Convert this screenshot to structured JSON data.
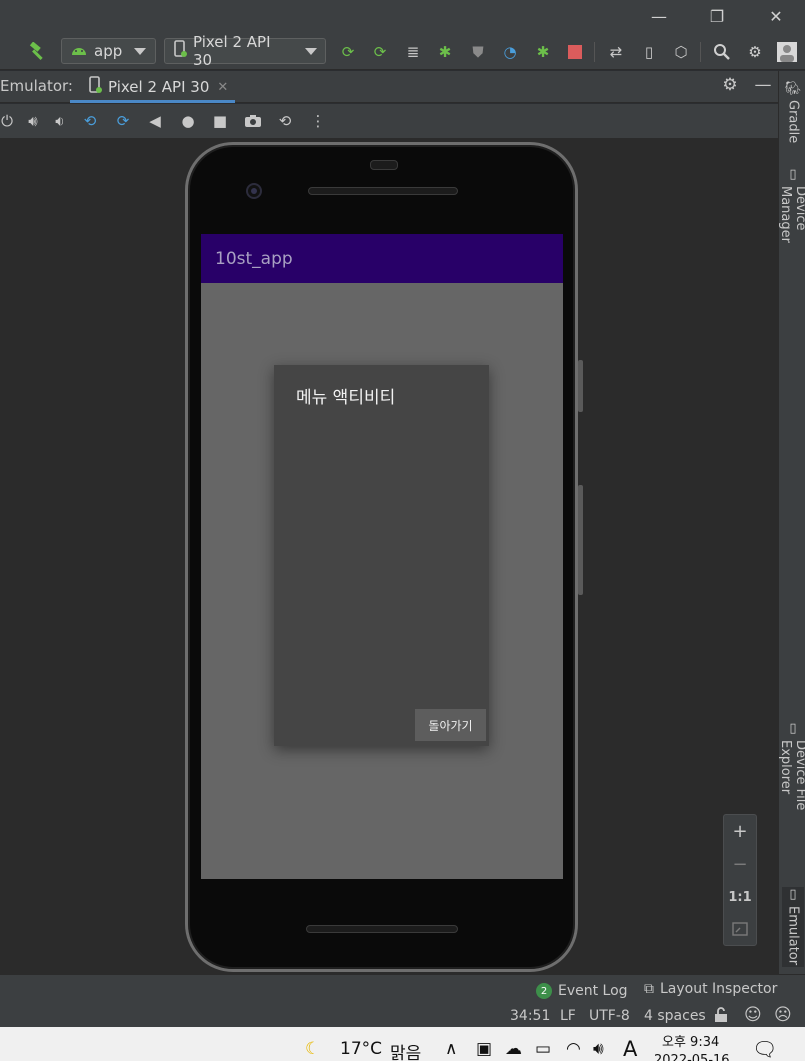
{
  "toolbar": {
    "run_config": "app",
    "device": "Pixel 2 API 30"
  },
  "tabs": {
    "emulator_label": "Emulator:",
    "device_tab": "Pixel 2 API 30",
    "close_glyph": "✕"
  },
  "side_panels": {
    "gradle": "Gradle",
    "device_manager": "Device Manager",
    "device_file_explorer": "Device File Explorer",
    "emulator": "Emulator"
  },
  "app": {
    "title": "10st_app",
    "dialog_title": "메뉴 액티비티",
    "back_button": "돌아가기",
    "colors": {
      "appbar": "#280068",
      "screen": "#666666",
      "dialog": "#454545"
    }
  },
  "zoom": {
    "zoom_in": "+",
    "zoom_out": "−",
    "actual_size": "1:1"
  },
  "statusbar": {
    "event_log_count": "2",
    "event_log": "Event Log",
    "layout_inspector": "Layout Inspector",
    "position": "34:51",
    "line_separator": "LF",
    "encoding": "UTF-8",
    "indent": "4 spaces"
  },
  "taskbar": {
    "temperature": "17°C",
    "weather": "맑음",
    "ime": "A",
    "time": "오후 9:34",
    "date": "2022-05-16"
  }
}
